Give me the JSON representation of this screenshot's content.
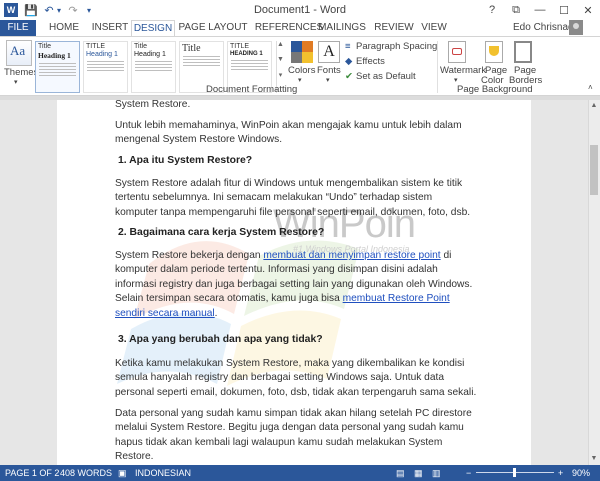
{
  "window": {
    "title": "Document1 - Word",
    "help": "?",
    "restore_ribbon": "⧉",
    "minimize": "—",
    "maximize": "☐",
    "close": "✕"
  },
  "quick_access": {
    "save": "💾",
    "undo": "↶",
    "undo_dropdown": "▾",
    "redo": "↷",
    "customize": "▾"
  },
  "tabs": [
    {
      "label": "FILE"
    },
    {
      "label": "HOME"
    },
    {
      "label": "INSERT"
    },
    {
      "label": "DESIGN"
    },
    {
      "label": "PAGE LAYOUT"
    },
    {
      "label": "REFERENCES"
    },
    {
      "label": "MAILINGS"
    },
    {
      "label": "REVIEW"
    },
    {
      "label": "VIEW"
    }
  ],
  "active_tab": "DESIGN",
  "user": {
    "name": "Edo Chrisnado"
  },
  "ribbon": {
    "themes_label": "Themes",
    "style_set": [
      {
        "title": "Title",
        "heading": "Heading 1"
      },
      {
        "title": "TITLE",
        "heading": "Heading 1"
      },
      {
        "title": "Title",
        "heading": "Heading 1"
      },
      {
        "title": "Title",
        "heading": ""
      },
      {
        "title": "TITLE",
        "heading": "HEADING 1"
      }
    ],
    "colors_label": "Colors",
    "fonts_label": "Fonts",
    "paragraph_spacing": "Paragraph Spacing",
    "effects": "Effects",
    "set_as_default": "Set as Default",
    "group_document_formatting": "Document Formatting",
    "watermark": "Watermark",
    "page_color_1": "Page",
    "page_color_2": "Color",
    "page_borders_1": "Page",
    "page_borders_2": "Borders",
    "group_page_background": "Page Background"
  },
  "document": {
    "watermark": "WinPoin",
    "watermark_sub": "#1 Windows Portal Indonesia",
    "line_top": "System Restore.",
    "para_intro": "Untuk lebih memahaminya, WinPoin akan mengajak kamu untuk lebih dalam mengenal System Restore Windows.",
    "h1": "1. Apa itu System Restore?",
    "para1": "System Restore adalah fitur di Windows untuk mengembalikan sistem ke titik tertentu sebelumnya. Ini semacam melakukan “Undo” terhadap sistem komputer tanpa mempengaruhi file personal seperti email, dokumen, foto, dsb.",
    "h2": "2. Bagaimana cara kerja System Restore?",
    "para2_a": "System Restore bekerja dengan ",
    "para2_link1": "membuat dan menyimpan restore point",
    "para2_b": " di komputer dalam periode tertentu. Informasi yang disimpan disini adalah informasi registry dan juga berbagai setting lain yang digunakan oleh Windows. Selain tersimpan secara otomatis, kamu juga bisa ",
    "para2_link2": "membuat Restore Point sendiri secara manual",
    "para2_c": ".",
    "h3": "3. Apa yang berubah dan apa yang tidak?",
    "para3": "Ketika kamu melakukan System Restore, maka yang dikembalikan ke kondisi semula hanyalah registry dan berbagai setting Windows saja. Untuk data personal seperti email, dokumen, foto, dsb, tidak akan terpengaruh sama sekali.",
    "para4": "Data personal yang sudah kamu simpan tidak akan hilang setelah PC direstore melalui System Restore. Begitu juga dengan data personal yang sudah kamu hapus tidak akan kembali lagi walaupun kamu sudah melakukan System Restore."
  },
  "status": {
    "page": "PAGE 1 OF 2",
    "words": "408 WORDS",
    "language": "INDONESIAN",
    "zoom": "90%",
    "zoom_out": "−",
    "zoom_in": "+"
  },
  "colors": {
    "accent": "#2b579a",
    "link": "#1f4fbf"
  }
}
